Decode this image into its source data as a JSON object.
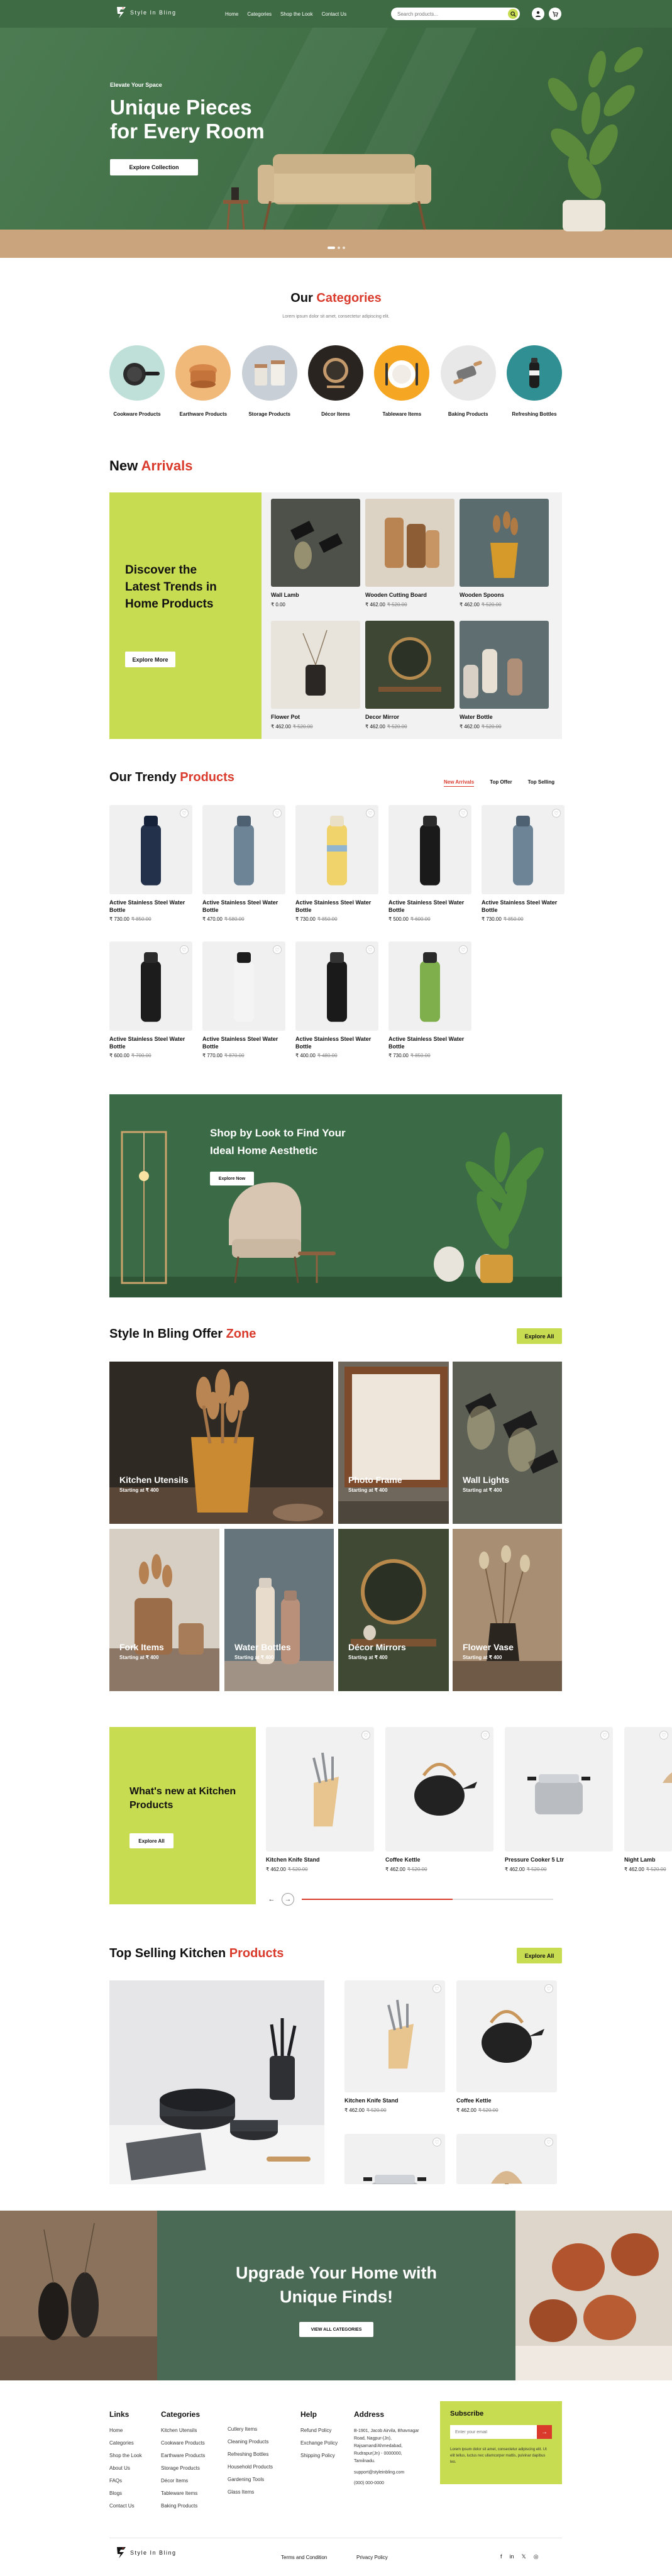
{
  "nav": {
    "brand": "Style In Bling",
    "links": [
      "Home",
      "Categories",
      "Shop the Look",
      "Contact Us"
    ],
    "search_placeholder": "Search products..."
  },
  "hero": {
    "eyebrow": "Elevate Your Space",
    "title_line1": "Unique Pieces",
    "title_line2": "for Every Room",
    "button": "Explore Collection"
  },
  "categories": {
    "title_a": "Our ",
    "title_b": "Categories",
    "subtitle": "Lorem ipsum dolor sit amet, consectetur adipiscing elit.",
    "items": [
      "Cookware Products",
      "Earthware Products",
      "Storage Products",
      "Décor Items",
      "Tableware Items",
      "Baking Products",
      "Refreshing Bottles"
    ]
  },
  "arrivals": {
    "title_a": "New ",
    "title_b": "Arrivals",
    "promo": "Discover the Latest Trends in Home Products",
    "promo_btn": "Explore More",
    "items": [
      {
        "name": "Wall Lamb",
        "price": "₹ 0.00",
        "old": ""
      },
      {
        "name": "Wooden Cutting Board",
        "price": "₹ 462.00",
        "old": "₹ 520.00"
      },
      {
        "name": "Wooden Spoons",
        "price": "₹ 462.00",
        "old": "₹ 520.00"
      },
      {
        "name": "Flower Pot",
        "price": "₹ 462.00",
        "old": "₹ 520.00"
      },
      {
        "name": "Decor Mirror",
        "price": "₹ 462.00",
        "old": "₹ 520.00"
      },
      {
        "name": "Water Bottle",
        "price": "₹ 462.00",
        "old": "₹ 520.00"
      }
    ]
  },
  "trendy": {
    "title_a": "Our Trendy ",
    "title_b": "Products",
    "tabs": [
      "New Arrivals",
      "Top Offer",
      "Top Selling"
    ],
    "items": [
      {
        "name": "Active Stainless Steel Water Bottle",
        "price": "₹ 730.00",
        "old": "₹ 850.00"
      },
      {
        "name": "Active Stainless Steel Water Bottle",
        "price": "₹ 470.00",
        "old": "₹ 580.00"
      },
      {
        "name": "Active Stainless Steel Water Bottle",
        "price": "₹ 730.00",
        "old": "₹ 850.00"
      },
      {
        "name": "Active Stainless Steel Water Bottle",
        "price": "₹ 500.00",
        "old": "₹ 600.00"
      },
      {
        "name": "Active Stainless Steel Water Bottle",
        "price": "₹ 730.00",
        "old": "₹ 850.00"
      },
      {
        "name": "Active Stainless Steel Water Bottle",
        "price": "₹ 600.00",
        "old": "₹ 700.00"
      },
      {
        "name": "Active Stainless Steel Water Bottle",
        "price": "₹ 770.00",
        "old": "₹ 870.00"
      },
      {
        "name": "Active Stainless Steel Water Bottle",
        "price": "₹ 400.00",
        "old": "₹ 480.00"
      },
      {
        "name": "Active Stainless Steel Water Bottle",
        "price": "₹ 730.00",
        "old": "₹ 850.00"
      }
    ]
  },
  "look": {
    "title_line1": "Shop by Look to Find Your",
    "title_line2": "Ideal Home Aesthetic",
    "button": "Explore Now"
  },
  "offer": {
    "title_a": "Style In Bling Offer ",
    "title_b": "Zone",
    "button": "Explore All",
    "tiles": [
      {
        "title": "Kitchen Utensils",
        "sub": "Starting at ₹ 400"
      },
      {
        "title": "Photo Frame",
        "sub": "Starting at ₹ 400"
      },
      {
        "title": "Wall Lights",
        "sub": "Starting at ₹ 400"
      },
      {
        "title": "Fork Items",
        "sub": "Starting at ₹ 400"
      },
      {
        "title": "Water Bottles",
        "sub": "Starting at ₹ 400"
      },
      {
        "title": "Décor Mirrors",
        "sub": "Starting at ₹ 400"
      },
      {
        "title": "Flower Vase",
        "sub": "Starting at ₹ 400"
      }
    ]
  },
  "kitchen": {
    "promo": "What's new at Kitchen Products",
    "promo_btn": "Explore All",
    "items": [
      {
        "name": "Kitchen Knife Stand",
        "price": "₹ 462.00",
        "old": "₹ 520.00"
      },
      {
        "name": "Coffee Kettle",
        "price": "₹ 462.00",
        "old": "₹ 520.00"
      },
      {
        "name": "Pressure Cooker 5 Ltr",
        "price": "₹ 462.00",
        "old": "₹ 520.00"
      },
      {
        "name": "Night Lamb",
        "price": "₹ 462.00",
        "old": "₹ 520.00"
      }
    ],
    "slider_progress": 0.6
  },
  "topselling": {
    "title_a": "Top Selling Kitchen ",
    "title_b": "Products",
    "button": "Explore All",
    "items": [
      {
        "name": "Kitchen Knife Stand",
        "price": "₹ 462.00",
        "old": "₹ 520.00"
      },
      {
        "name": "Coffee Kettle",
        "price": "₹ 462.00",
        "old": "₹ 520.00"
      }
    ]
  },
  "upgrade": {
    "title_line1": "Upgrade Your Home with",
    "title_line2": "Unique Finds!",
    "button": "VIEW ALL CATEGORIES"
  },
  "footer": {
    "links_title": "Links",
    "links": [
      "Home",
      "Categories",
      "Shop the Look",
      "About Us",
      "FAQs",
      "Blogs",
      "Contact Us"
    ],
    "cat_title": "Categories",
    "cat1": [
      "Kitchen Utensils",
      "Cookware Products",
      "Earthware Products",
      "Storage Products",
      "Décor Items",
      "Tableware Items",
      "Baking Products"
    ],
    "cat2": [
      "Cutlery Items",
      "Cleaning Products",
      "Refreshing Bottles",
      "Household Products",
      "Gardening Tools",
      "Glass Items"
    ],
    "help_title": "Help",
    "help": [
      "Refund Policy",
      "Exchange Policy",
      "Shipping Policy"
    ],
    "addr_title": "Address",
    "address": "B-1901, Jacob Airvila, Bhavnagar Road, Nagpur-(Jn), Rajsamand/Ahmedabad, Rudrapur(Jn) - 0000000, Tamilnadu.",
    "email": "support@styleinbling.com",
    "phone": "(000) 000-0000",
    "sub_title": "Subscribe",
    "sub_placeholder": "Enter your email",
    "sub_text": "Lorem ipsum dolor sit amet, consectetur adipiscing elit. Ut elit tellus, luctus nec ullamcorper mattis, pulvinar dapibus leo.",
    "terms": "Terms and Condition",
    "privacy": "Privacy Policy",
    "social": [
      "f",
      "in",
      "𝕏",
      "◎"
    ]
  },
  "colors": {
    "accent_red": "#d93a2b",
    "lime": "#c8dc52",
    "green": "#3f6e45",
    "dark_green": "#4b6a55"
  }
}
